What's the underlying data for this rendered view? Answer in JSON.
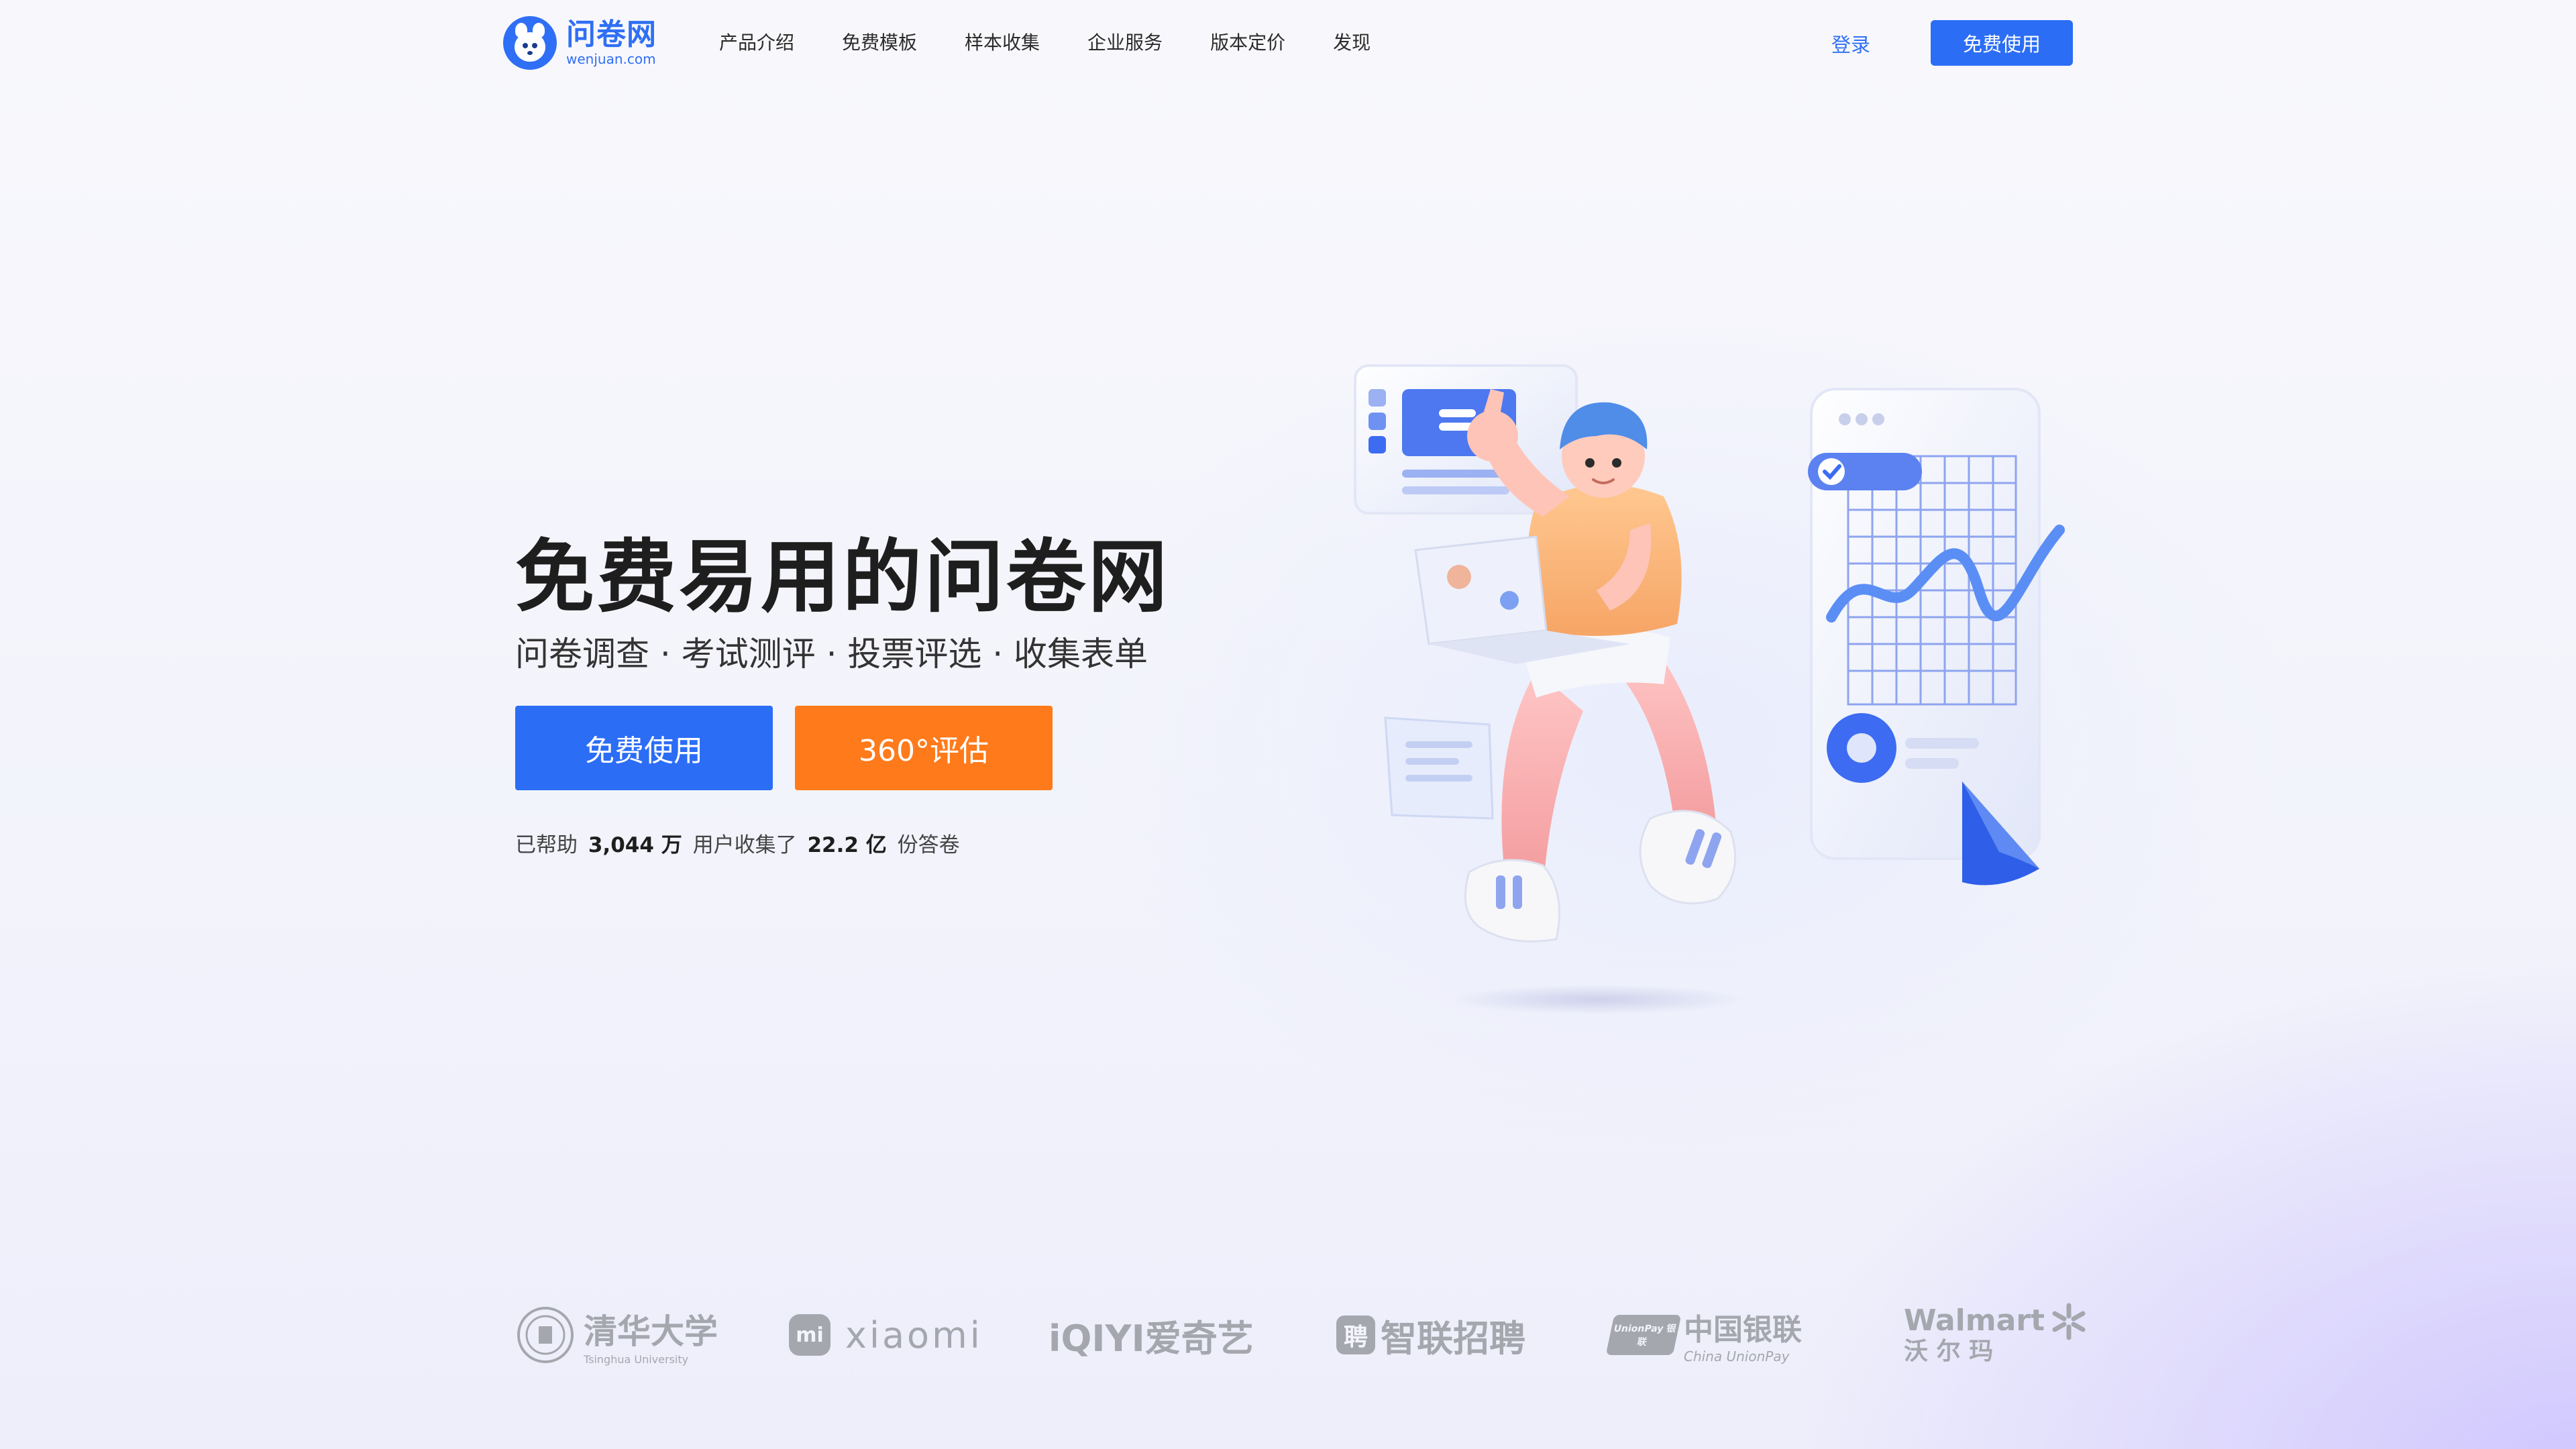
{
  "brand": {
    "name": "问卷网",
    "domain": "wenjuan.com",
    "primary_color": "#2b6df5",
    "accent_color": "#ff7a1a"
  },
  "nav": {
    "items": [
      "产品介绍",
      "免费模板",
      "样本收集",
      "企业服务",
      "版本定价",
      "发现"
    ],
    "login": "登录",
    "cta": "免费使用"
  },
  "hero": {
    "title": "免费易用的问卷网",
    "subtitle": "问卷调查 · 考试测评 · 投票评选 · 收集表单",
    "primary_button": "免费使用",
    "secondary_button": "360°评估",
    "stats": {
      "prefix": "已帮助",
      "users": "3,044 万",
      "middle": "用户收集了",
      "responses": "22.2 亿",
      "suffix": "份答卷"
    }
  },
  "partners": [
    {
      "name": "清华大学",
      "sub": "Tsinghua University"
    },
    {
      "name": "xiaomi",
      "badge": "mi"
    },
    {
      "name": "iQIYI爱奇艺"
    },
    {
      "name": "智联招聘",
      "badge": "聘"
    },
    {
      "name": "中国银联",
      "sub": "China UnionPay",
      "badge": "UnionPay 银联"
    },
    {
      "name": "Walmart",
      "sub": "沃 尔 玛"
    }
  ]
}
